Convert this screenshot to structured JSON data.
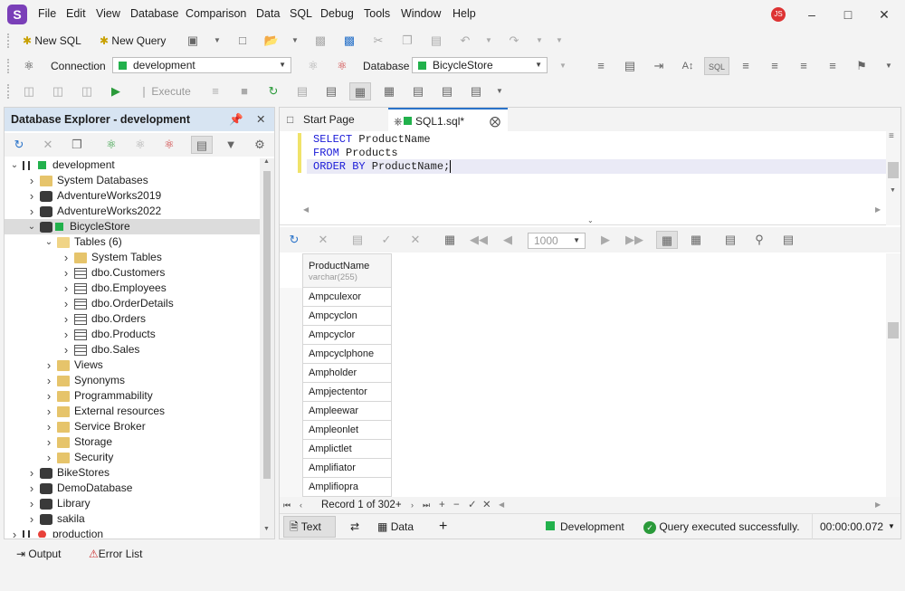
{
  "app": {
    "logo": "S",
    "user_initials": "JS"
  },
  "menu": [
    "File",
    "Edit",
    "View",
    "Database",
    "Comparison",
    "Data",
    "SQL",
    "Debug",
    "Tools",
    "Window",
    "Help"
  ],
  "toolbar1": {
    "new_sql": "New SQL",
    "new_query": "New Query"
  },
  "toolbar2": {
    "connection_label": "Connection",
    "connection_value": "development",
    "database_label": "Database",
    "database_value": "BicycleStore"
  },
  "toolbar3": {
    "execute_label": "Execute"
  },
  "explorer": {
    "title": "Database Explorer - development",
    "tree": [
      {
        "label": "development",
        "level": 0,
        "icon": "connection",
        "status": "green",
        "expanded": true
      },
      {
        "label": "System Databases",
        "level": 1,
        "icon": "folder"
      },
      {
        "label": "AdventureWorks2019",
        "level": 1,
        "icon": "database"
      },
      {
        "label": "AdventureWorks2022",
        "level": 1,
        "icon": "database"
      },
      {
        "label": "BicycleStore",
        "level": 1,
        "icon": "database",
        "status": "green",
        "expanded": true,
        "selected": true
      },
      {
        "label": "Tables (6)",
        "level": 2,
        "icon": "folder-open",
        "expanded": true
      },
      {
        "label": "System Tables",
        "level": 3,
        "icon": "folder"
      },
      {
        "label": "dbo.Customers",
        "level": 3,
        "icon": "table"
      },
      {
        "label": "dbo.Employees",
        "level": 3,
        "icon": "table"
      },
      {
        "label": "dbo.OrderDetails",
        "level": 3,
        "icon": "table"
      },
      {
        "label": "dbo.Orders",
        "level": 3,
        "icon": "table"
      },
      {
        "label": "dbo.Products",
        "level": 3,
        "icon": "table"
      },
      {
        "label": "dbo.Sales",
        "level": 3,
        "icon": "table"
      },
      {
        "label": "Views",
        "level": 2,
        "icon": "folder"
      },
      {
        "label": "Synonyms",
        "level": 2,
        "icon": "folder"
      },
      {
        "label": "Programmability",
        "level": 2,
        "icon": "folder"
      },
      {
        "label": "External resources",
        "level": 2,
        "icon": "folder"
      },
      {
        "label": "Service Broker",
        "level": 2,
        "icon": "folder"
      },
      {
        "label": "Storage",
        "level": 2,
        "icon": "folder"
      },
      {
        "label": "Security",
        "level": 2,
        "icon": "folder"
      },
      {
        "label": "BikeStores",
        "level": 1,
        "icon": "database"
      },
      {
        "label": "DemoDatabase",
        "level": 1,
        "icon": "database"
      },
      {
        "label": "Library",
        "level": 1,
        "icon": "database"
      },
      {
        "label": "sakila",
        "level": 1,
        "icon": "database"
      },
      {
        "label": "production",
        "level": 0,
        "icon": "connection",
        "status": "red"
      }
    ]
  },
  "tabs": [
    {
      "label": "Start Page",
      "active": false
    },
    {
      "label": "SQL1.sql*",
      "active": true
    }
  ],
  "editor": {
    "lines": [
      {
        "kw": "SELECT",
        "rest": " ProductName"
      },
      {
        "kw": "FROM",
        "rest": " Products"
      },
      {
        "kw": "ORDER BY",
        "rest": " ProductName;"
      }
    ]
  },
  "grid": {
    "page_size": "1000",
    "column": {
      "name": "ProductName",
      "type": "varchar(255)"
    },
    "rows": [
      "Ampculexor",
      "Ampcyclon",
      "Ampcyclor",
      "Ampcyclphone",
      "Ampholder",
      "Ampjectentor",
      "Ampleewar",
      "Ampleonlet",
      "Amplictlet",
      "Amplifiator",
      "Amplifiopra"
    ],
    "record_text": "Record 1 of 302+"
  },
  "bottom": {
    "text_tab": "Text",
    "data_tab": "Data",
    "connection": "Development",
    "status": "Query executed successfully.",
    "elapsed": "00:00:00.072"
  },
  "output": {
    "output_label": "Output",
    "error_list_label": "Error List"
  },
  "colors": {
    "accent": "#2a73c9",
    "ok": "#22b14c",
    "error": "#e8413a",
    "brand": "#7a3fb8"
  }
}
